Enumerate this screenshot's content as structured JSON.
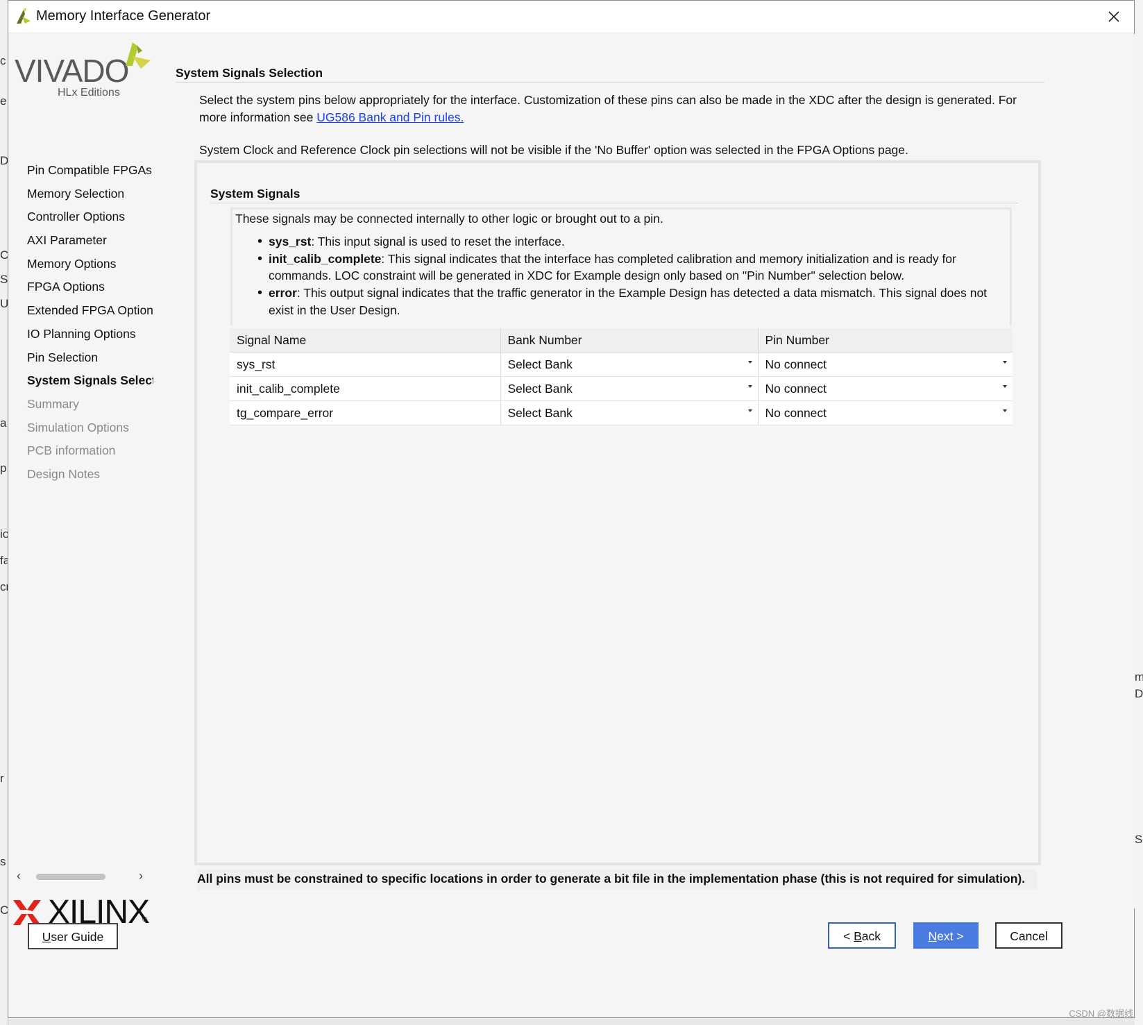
{
  "window": {
    "title": "Memory Interface Generator",
    "close_icon": "close-icon"
  },
  "sidebar": {
    "vivado_logo_word": "VIVADO",
    "vivado_logo_sub": "HLx Editions",
    "steps": [
      {
        "label": "Pin Compatible FPGAs",
        "state": "done"
      },
      {
        "label": "Memory Selection",
        "state": "done"
      },
      {
        "label": "Controller Options",
        "state": "done"
      },
      {
        "label": "AXI Parameter",
        "state": "done"
      },
      {
        "label": "Memory Options",
        "state": "done"
      },
      {
        "label": "FPGA Options",
        "state": "done"
      },
      {
        "label": "Extended FPGA Options",
        "state": "done"
      },
      {
        "label": "IO Planning Options",
        "state": "done"
      },
      {
        "label": "Pin Selection",
        "state": "done"
      },
      {
        "label": "System Signals Selection",
        "state": "active"
      },
      {
        "label": "Summary",
        "state": "future"
      },
      {
        "label": "Simulation Options",
        "state": "future"
      },
      {
        "label": "PCB information",
        "state": "future"
      },
      {
        "label": "Design Notes",
        "state": "future"
      }
    ],
    "xilinx_logo_word": "XILINX",
    "xilinx_logo_reg": "®"
  },
  "main": {
    "section_title": "System Signals Selection",
    "description_text": "Select the system pins below appropriately for the interface. Customization of these pins can also be made in the XDC after the design is generated. For more information see ",
    "description_link": "UG586 Bank and Pin rules.",
    "clock_note": "System Clock and Reference Clock pin selections will not be visible if the 'No Buffer' option was selected in the FPGA Options page.",
    "panel_title": "System Signals",
    "info_intro": "These signals may be connected internally to other logic or brought out to a pin.",
    "info_items": [
      {
        "name": "sys_rst",
        "text": ": This input signal is used to reset the interface."
      },
      {
        "name": "init_calib_complete",
        "text": ": This signal indicates that the interface has completed calibration and memory initialization and is ready for commands. LOC constraint will be generated in XDC for Example design only based on \"Pin Number\" selection below."
      },
      {
        "name": "error",
        "text": ": This output signal indicates that the traffic generator in the Example Design has detected a data mismatch. This signal does not exist in the User Design."
      }
    ],
    "table": {
      "headers": [
        "Signal Name",
        "Bank Number",
        "Pin Number"
      ],
      "rows": [
        {
          "signal": "sys_rst",
          "bank": "Select Bank",
          "pin": "No connect"
        },
        {
          "signal": "init_calib_complete",
          "bank": "Select Bank",
          "pin": "No connect"
        },
        {
          "signal": "tg_compare_error",
          "bank": "Select Bank",
          "pin": "No connect"
        }
      ]
    },
    "footnote": "All pins must be constrained to specific locations in order to generate a bit file in the implementation phase (this is not required for simulation)."
  },
  "buttons": {
    "user_guide": {
      "underlined": "U",
      "rest": "ser Guide"
    },
    "back": {
      "prefix": "< ",
      "underlined": "B",
      "rest": "ack"
    },
    "next": {
      "underlined": "N",
      "rest": "ext >"
    },
    "cancel": "Cancel"
  },
  "watermark": "CSDN @数据线",
  "colors": {
    "link": "#1a3fff",
    "primary_button": "#4a7be0",
    "back_border": "#3460c8",
    "vivado_green": "#b5c930"
  }
}
